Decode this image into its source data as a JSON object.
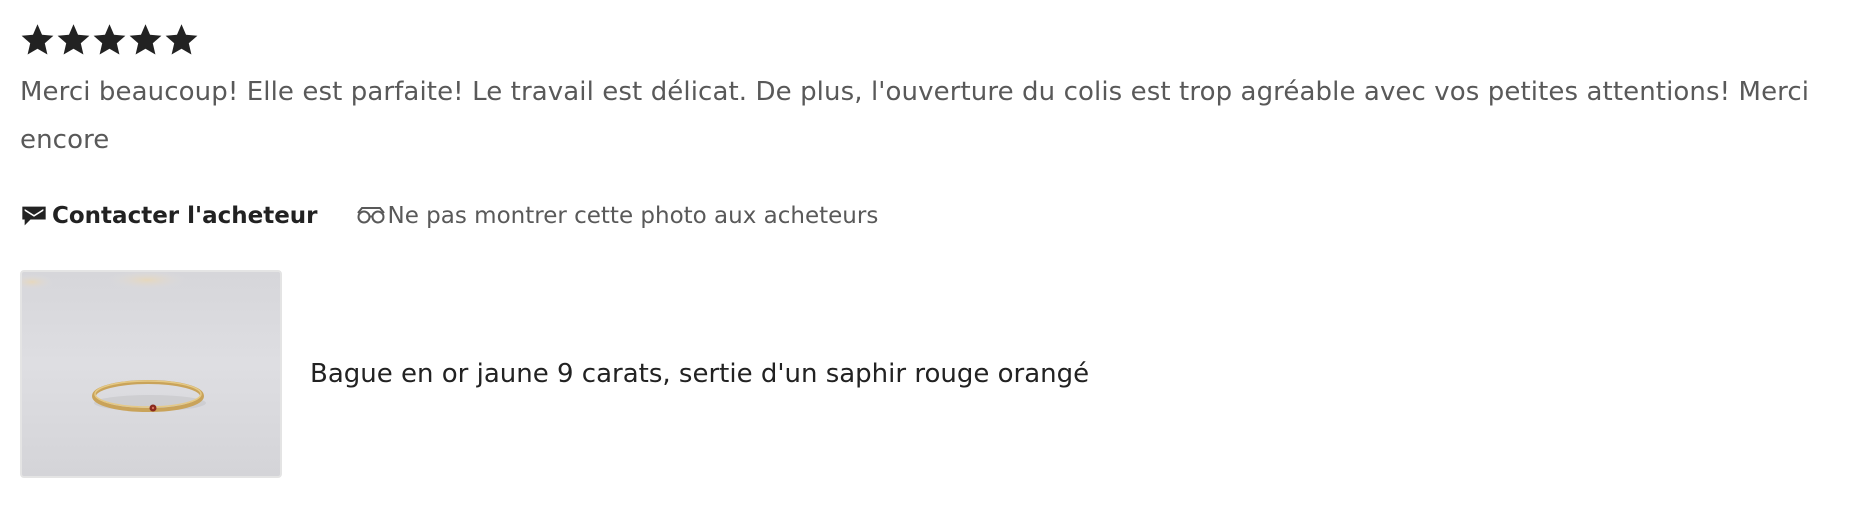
{
  "review": {
    "rating": 5,
    "rating_max": 5,
    "text": "Merci beaucoup! Elle est parfaite! Le travail est délicat. De plus, l'ouverture du colis est trop agréable avec vos petites attentions! Merci encore"
  },
  "actions": {
    "contact_label": "Contacter l'acheteur",
    "contact_icon": "message-icon",
    "hide_photo_label": "Ne pas montrer cette photo aux acheteurs",
    "hide_photo_icon": "eye-hidden-icon"
  },
  "product": {
    "title": "Bague en or jaune 9 carats, sertie d'un saphir rouge orangé",
    "image_icon": "ring-photo"
  },
  "colors": {
    "star": "#222222",
    "text_muted": "#595959",
    "text_dark": "#222222",
    "ring_gold": "#c9a35a",
    "stone": "#8a2a1e"
  }
}
